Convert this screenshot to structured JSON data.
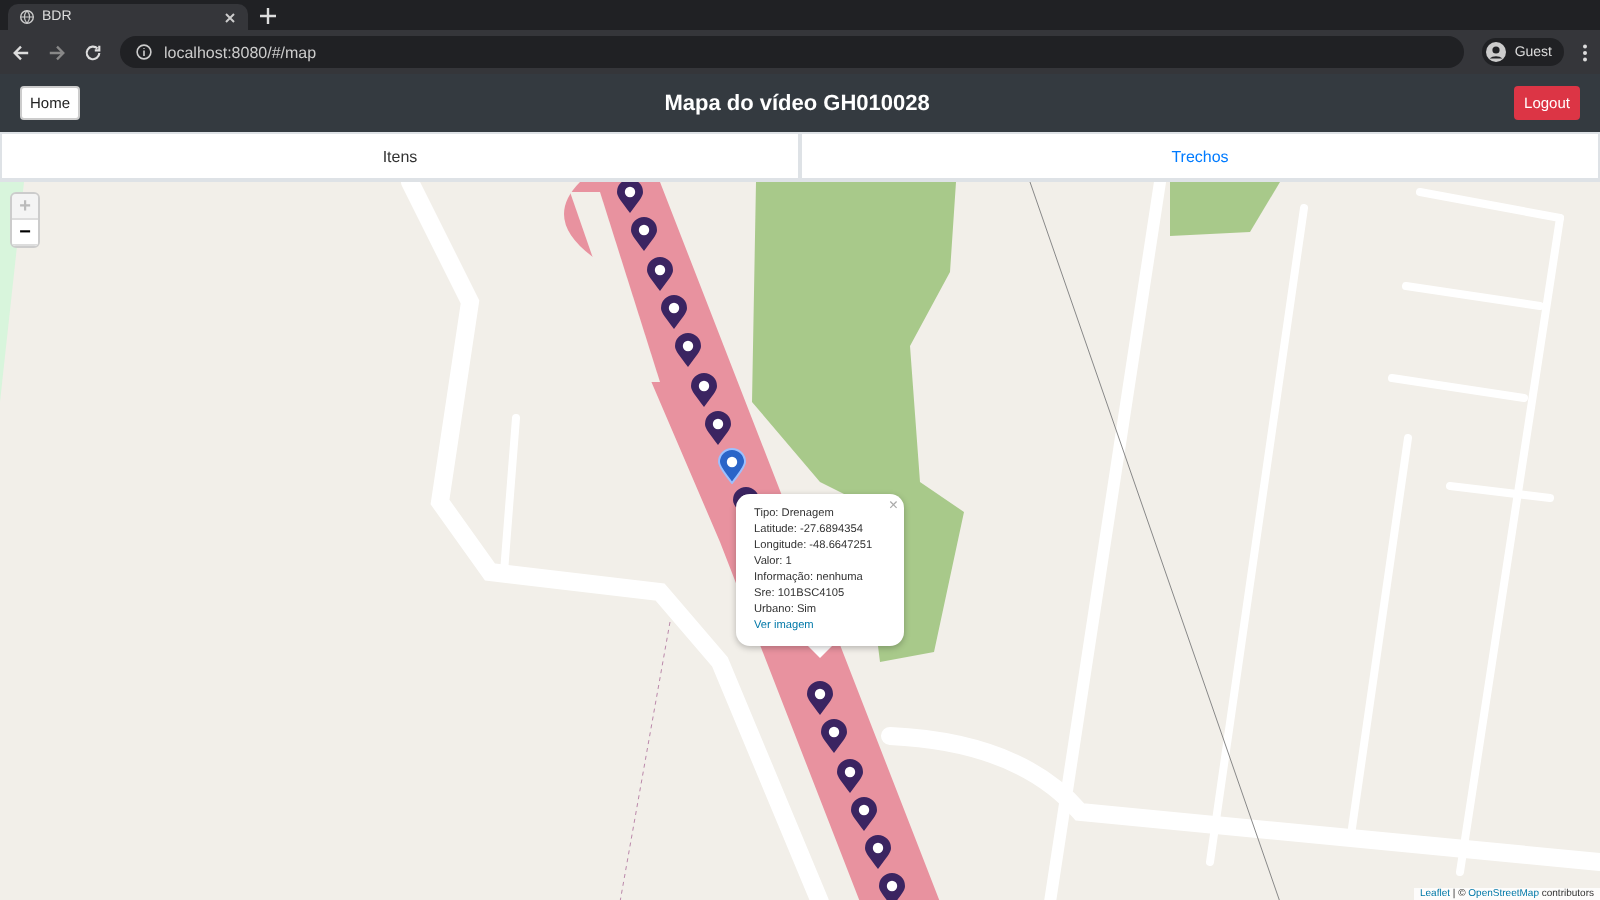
{
  "browser": {
    "tab_title": "BDR",
    "url": "localhost:8080/#/map",
    "profile": "Guest"
  },
  "header": {
    "home_button": "Home",
    "title": "Mapa do vídeo GH010028",
    "logout_button": "Logout"
  },
  "tabs": [
    {
      "label": "Itens",
      "selected": false
    },
    {
      "label": "Trechos",
      "selected": true
    }
  ],
  "map": {
    "zoom_in": "+",
    "zoom_out": "−",
    "zoom_in_disabled": true,
    "markers": [
      {
        "selected": false
      },
      {
        "selected": false
      },
      {
        "selected": false
      },
      {
        "selected": false
      },
      {
        "selected": false
      },
      {
        "selected": false
      },
      {
        "selected": false
      },
      {
        "selected": true
      },
      {
        "selected": false
      },
      {
        "selected": false
      },
      {
        "selected": false
      },
      {
        "selected": false
      },
      {
        "selected": false
      },
      {
        "selected": false
      },
      {
        "selected": false
      }
    ],
    "popup": {
      "close": "×",
      "lines": [
        "Tipo: Drenagem",
        "Latitude: -27.6894354",
        "Longitude:  -48.6647251",
        "Valor: 1",
        "Informação: nenhuma",
        "Sre: 101BSC4105",
        "Urbano: Sim"
      ],
      "link": "Ver imagem"
    },
    "attribution": {
      "leaflet": "Leaflet",
      "separator": " | © ",
      "osm": "OpenStreetMap",
      "suffix": " contributors"
    }
  }
}
